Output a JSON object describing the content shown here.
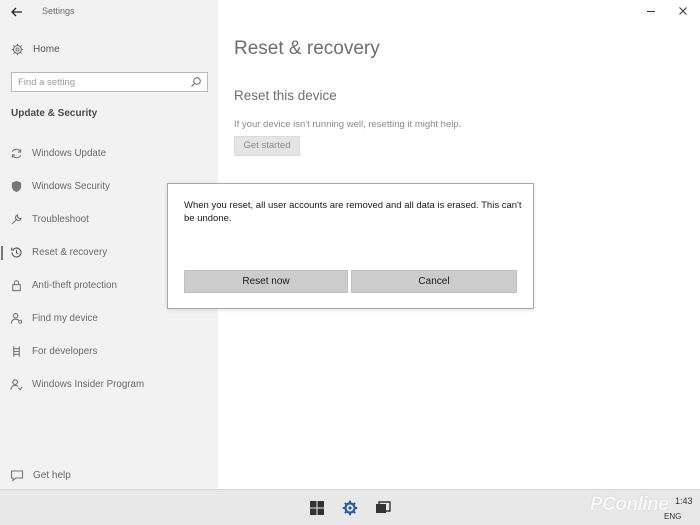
{
  "app": {
    "title": "Settings"
  },
  "sidebar": {
    "home_label": "Home",
    "search_placeholder": "Find a setting",
    "section_title": "Update & Security",
    "items": [
      {
        "label": "Windows Update",
        "icon": "sync-icon"
      },
      {
        "label": "Windows Security",
        "icon": "shield-icon"
      },
      {
        "label": "Troubleshoot",
        "icon": "wrench-icon"
      },
      {
        "label": "Reset & recovery",
        "icon": "history-icon",
        "active": true
      },
      {
        "label": "Anti-theft protection",
        "icon": "lock-icon"
      },
      {
        "label": "Find my device",
        "icon": "person-location-icon"
      },
      {
        "label": "For developers",
        "icon": "developer-tools-icon"
      },
      {
        "label": "Windows Insider Program",
        "icon": "insider-icon"
      }
    ],
    "get_help_label": "Get help"
  },
  "main": {
    "page_title": "Reset & recovery",
    "section_title": "Reset this device",
    "description": "If your device isn't running well, resetting it might help.",
    "get_started_label": "Get started"
  },
  "dialog": {
    "message": "When you reset, all user accounts are removed and all data is erased. This can't be undone.",
    "reset_now_label": "Reset now",
    "cancel_label": "Cancel"
  },
  "taskbar": {
    "icons": [
      "windows-start-icon",
      "settings-gear-icon",
      "task-view-icon"
    ],
    "time": "1:43",
    "language": "ENG"
  },
  "watermark": "PConline"
}
